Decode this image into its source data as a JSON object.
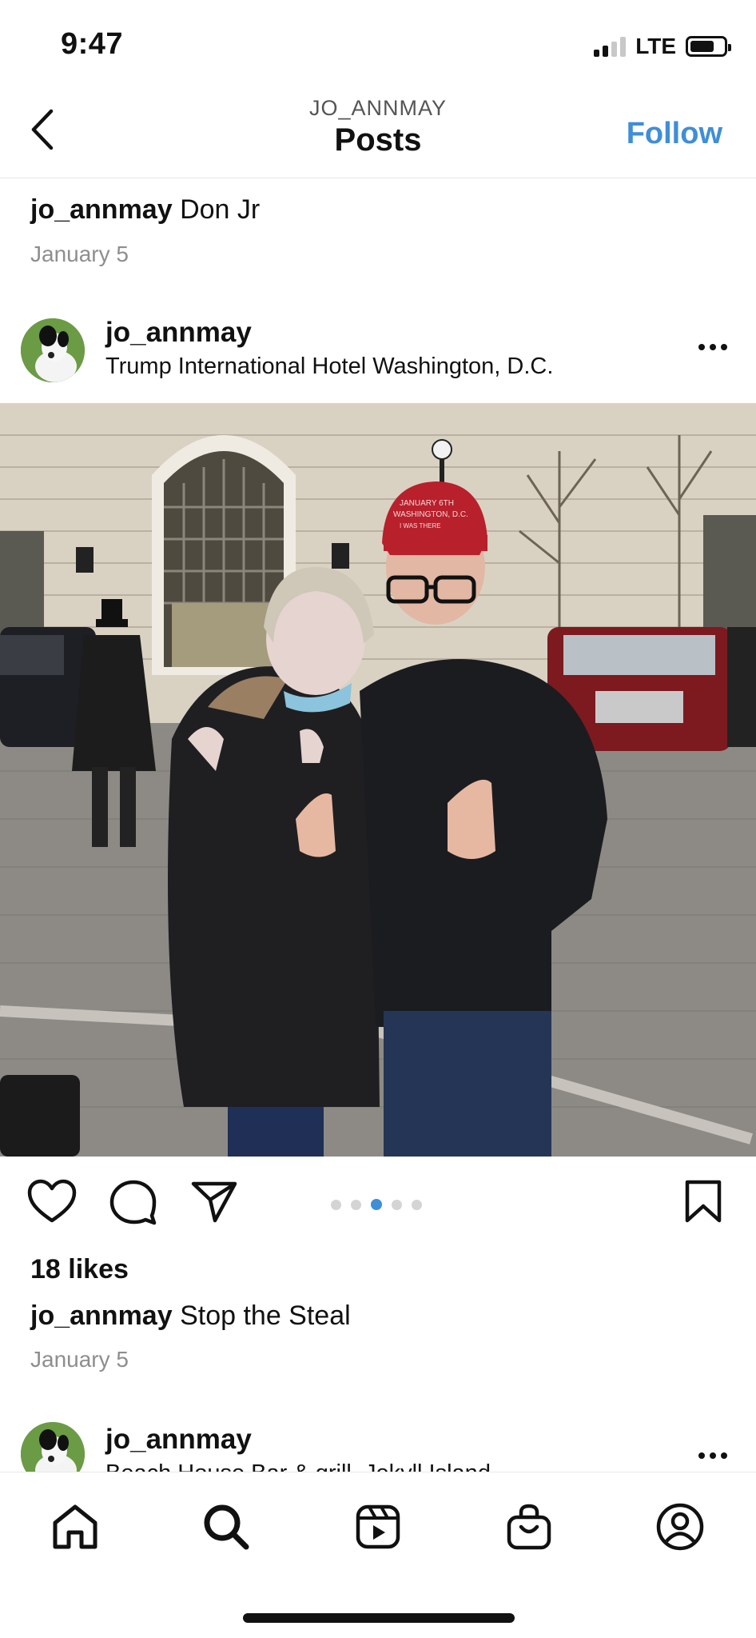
{
  "status_bar": {
    "time": "9:47",
    "network": "LTE"
  },
  "header": {
    "subtitle": "JO_ANNMAY",
    "title": "Posts",
    "follow_label": "Follow"
  },
  "previous_post": {
    "username": "jo_annmay",
    "caption": "Don Jr",
    "date": "January 5"
  },
  "post": {
    "username": "jo_annmay",
    "location": "Trump International Hotel Washington, D.C.",
    "carousel": {
      "total": 5,
      "active_index": 2
    },
    "likes": "18 likes",
    "caption_username": "jo_annmay",
    "caption": "Stop the Steal",
    "date": "January 5",
    "hat_text": [
      "JANUARY 6TH",
      "WASHINGTON, D.C.",
      "I WAS THERE"
    ]
  },
  "next_post": {
    "username": "jo_annmay",
    "location": "Beach House Bar & grill, Jekyll Island"
  },
  "tab_bar": {
    "items": [
      "home-icon",
      "search-icon",
      "reels-icon",
      "shop-icon",
      "profile-icon"
    ]
  },
  "colors": {
    "accent": "#3f8ed8",
    "muted": "#8e8e8e",
    "hat": "#b8202c"
  }
}
